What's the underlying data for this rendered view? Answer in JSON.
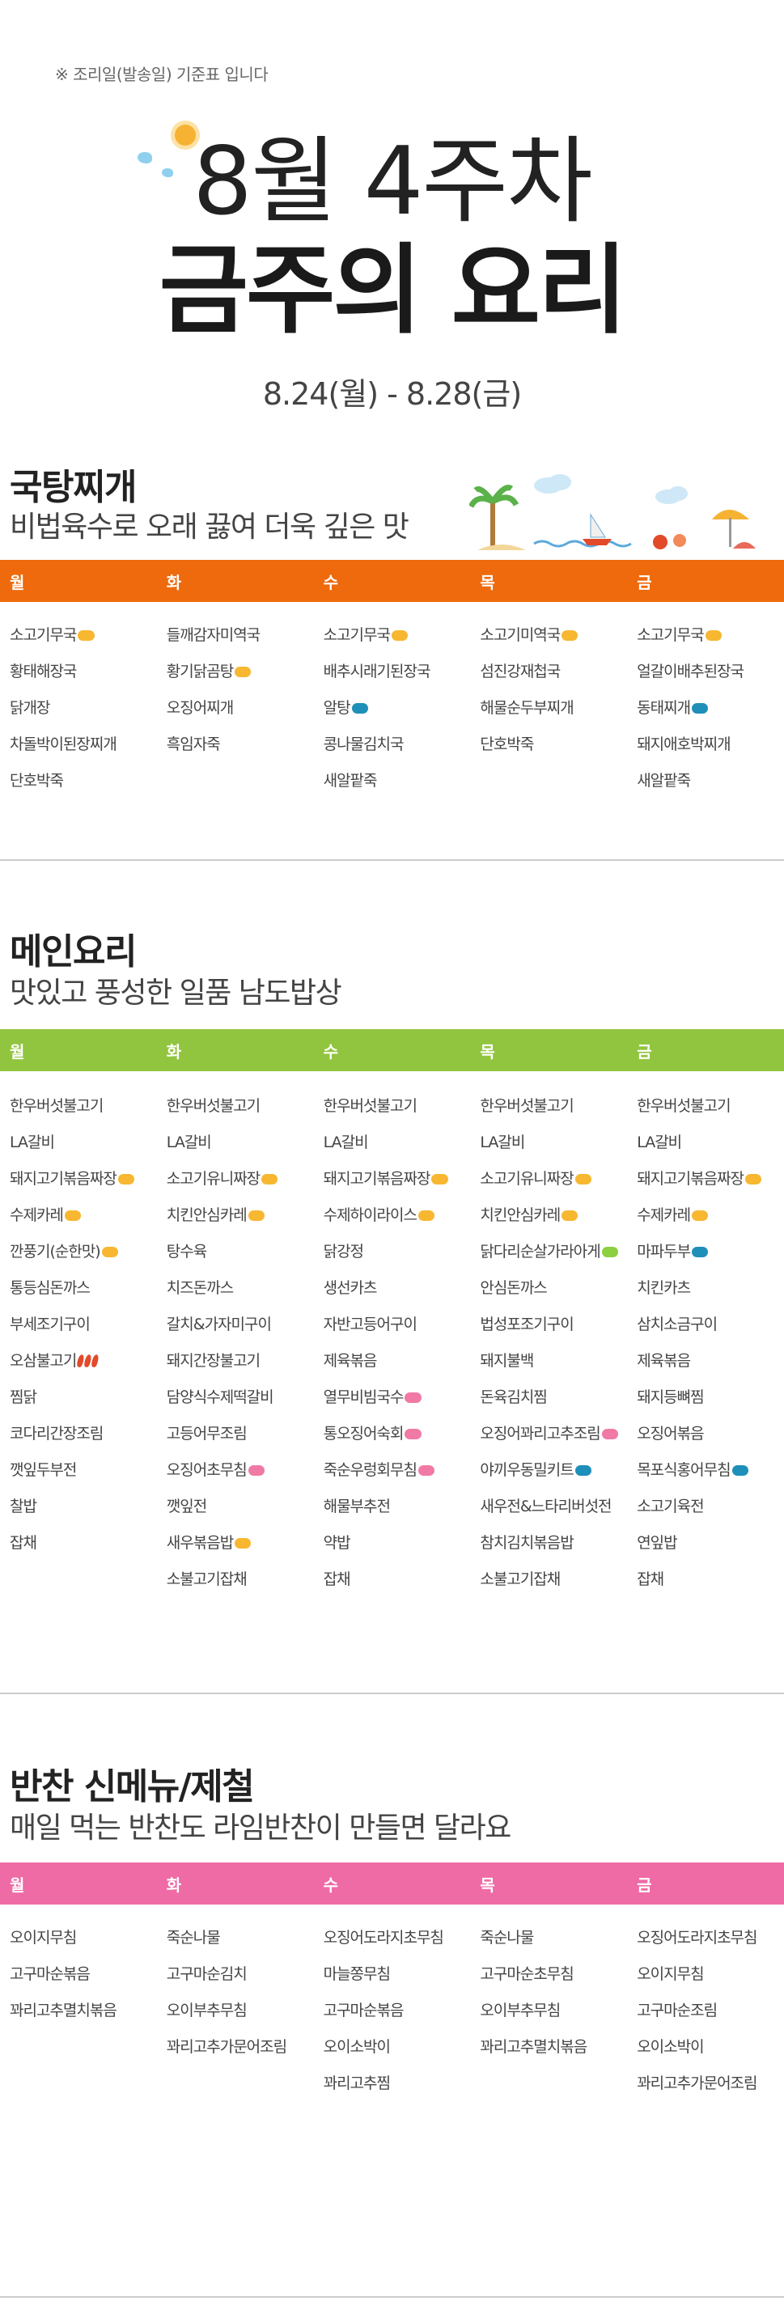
{
  "header": {
    "note": "※ 조리일(발송일) 기준표 입니다",
    "week": "8월 4주차",
    "headline": "금주의 요리",
    "period": "8.24(월) - 8.28(금)"
  },
  "colors": {
    "soup": "#ee6a0c",
    "main": "#92c53f",
    "side": "#ee6ba5"
  },
  "days": [
    "월",
    "화",
    "수",
    "목",
    "금"
  ],
  "soup": {
    "title": "국탕찌개",
    "subtitle": "비법육수로 오래 끓여 더욱 깊은 맛",
    "columns": [
      [
        {
          "t": "소고기무국",
          "tag": "y"
        },
        {
          "t": "황태해장국"
        },
        {
          "t": "닭개장"
        },
        {
          "t": "차돌박이된장찌개"
        },
        {
          "t": "단호박죽"
        }
      ],
      [
        {
          "t": "들깨감자미역국"
        },
        {
          "t": "황기닭곰탕",
          "tag": "y"
        },
        {
          "t": "오징어찌개"
        },
        {
          "t": "흑임자죽"
        }
      ],
      [
        {
          "t": "소고기무국",
          "tag": "y"
        },
        {
          "t": "배추시래기된장국"
        },
        {
          "t": "알탕",
          "tag": "b"
        },
        {
          "t": "콩나물김치국"
        },
        {
          "t": "새알팥죽"
        }
      ],
      [
        {
          "t": "소고기미역국",
          "tag": "y"
        },
        {
          "t": "섬진강재첩국"
        },
        {
          "t": "해물순두부찌개"
        },
        {
          "t": "단호박죽"
        }
      ],
      [
        {
          "t": "소고기무국",
          "tag": "y"
        },
        {
          "t": "얼갈이배추된장국"
        },
        {
          "t": "동태찌개",
          "tag": "b"
        },
        {
          "t": "돼지애호박찌개"
        },
        {
          "t": "새알팥죽"
        }
      ]
    ]
  },
  "main": {
    "title": "메인요리",
    "subtitle": "맛있고 풍성한 일품 남도밥상",
    "columns": [
      [
        {
          "t": "한우버섯불고기"
        },
        {
          "t": "LA갈비"
        },
        {
          "t": "돼지고기볶음짜장",
          "tag": "y"
        },
        {
          "t": "수제카레",
          "tag": "y"
        },
        {
          "t": "깐풍기(순한맛)",
          "tag": "y"
        },
        {
          "t": "통등심돈까스"
        },
        {
          "t": "부세조기구이"
        },
        {
          "t": "오삼불고기",
          "chili": true
        },
        {
          "t": "찜닭"
        },
        {
          "t": "코다리간장조림"
        },
        {
          "t": "깻잎두부전"
        },
        {
          "t": "찰밥"
        },
        {
          "t": "잡채"
        }
      ],
      [
        {
          "t": "한우버섯불고기"
        },
        {
          "t": "LA갈비"
        },
        {
          "t": "소고기유니짜장",
          "tag": "y"
        },
        {
          "t": "치킨안심카레",
          "tag": "y"
        },
        {
          "t": "탕수육"
        },
        {
          "t": "치즈돈까스"
        },
        {
          "t": "갈치&가자미구이"
        },
        {
          "t": "돼지간장불고기"
        },
        {
          "t": "담양식수제떡갈비"
        },
        {
          "t": "고등어무조림"
        },
        {
          "t": "오징어초무침",
          "tag": "p"
        },
        {
          "t": "깻잎전"
        },
        {
          "t": "새우볶음밥",
          "tag": "y"
        },
        {
          "t": "소불고기잡채"
        }
      ],
      [
        {
          "t": "한우버섯불고기"
        },
        {
          "t": "LA갈비"
        },
        {
          "t": "돼지고기볶음짜장",
          "tag": "y"
        },
        {
          "t": "수제하이라이스",
          "tag": "y"
        },
        {
          "t": "닭강정"
        },
        {
          "t": "생선카츠"
        },
        {
          "t": "자반고등어구이"
        },
        {
          "t": "제육볶음"
        },
        {
          "t": "열무비빔국수",
          "tag": "p"
        },
        {
          "t": "통오징어숙회",
          "tag": "p"
        },
        {
          "t": "죽순우렁회무침",
          "tag": "p"
        },
        {
          "t": "해물부추전"
        },
        {
          "t": "약밥"
        },
        {
          "t": "잡채"
        }
      ],
      [
        {
          "t": "한우버섯불고기"
        },
        {
          "t": "LA갈비"
        },
        {
          "t": "소고기유니짜장",
          "tag": "y"
        },
        {
          "t": "치킨안심카레",
          "tag": "y"
        },
        {
          "t": "닭다리순살가라아게",
          "tag": "g"
        },
        {
          "t": "안심돈까스"
        },
        {
          "t": "법성포조기구이"
        },
        {
          "t": "돼지불백"
        },
        {
          "t": "돈육김치찜"
        },
        {
          "t": "오징어꽈리고추조림",
          "tag": "p"
        },
        {
          "t": "야끼우동밀키트",
          "tag": "b"
        },
        {
          "t": "새우전&느타리버섯전"
        },
        {
          "t": "참치김치볶음밥"
        },
        {
          "t": "소불고기잡채"
        }
      ],
      [
        {
          "t": "한우버섯불고기"
        },
        {
          "t": "LA갈비"
        },
        {
          "t": "돼지고기볶음짜장",
          "tag": "y"
        },
        {
          "t": "수제카레",
          "tag": "y"
        },
        {
          "t": "마파두부",
          "tag": "b"
        },
        {
          "t": "치킨카츠"
        },
        {
          "t": "삼치소금구이"
        },
        {
          "t": "제육볶음"
        },
        {
          "t": "돼지등뼈찜"
        },
        {
          "t": "오징어볶음"
        },
        {
          "t": "목포식홍어무침",
          "tag": "b"
        },
        {
          "t": "소고기육전"
        },
        {
          "t": "연잎밥"
        },
        {
          "t": "잡채"
        }
      ]
    ]
  },
  "side": {
    "title": "반찬 신메뉴/제철",
    "subtitle": "매일 먹는 반찬도 라임반찬이 만들면 달라요",
    "columns": [
      [
        {
          "t": "오이지무침"
        },
        {
          "t": "고구마순볶음"
        },
        {
          "t": "꽈리고추멸치볶음"
        }
      ],
      [
        {
          "t": "죽순나물"
        },
        {
          "t": "고구마순김치"
        },
        {
          "t": "오이부추무침"
        },
        {
          "t": "꽈리고추가문어조림"
        }
      ],
      [
        {
          "t": "오징어도라지초무침"
        },
        {
          "t": "마늘쫑무침"
        },
        {
          "t": "고구마순볶음"
        },
        {
          "t": "오이소박이"
        },
        {
          "t": "꽈리고추찜"
        }
      ],
      [
        {
          "t": "죽순나물"
        },
        {
          "t": "고구마순초무침"
        },
        {
          "t": "오이부추무침"
        },
        {
          "t": "꽈리고추멸치볶음"
        }
      ],
      [
        {
          "t": "오징어도라지초무침"
        },
        {
          "t": "오이지무침"
        },
        {
          "t": "고구마순조림"
        },
        {
          "t": "오이소박이"
        },
        {
          "t": "꽈리고추가문어조림"
        }
      ]
    ]
  }
}
